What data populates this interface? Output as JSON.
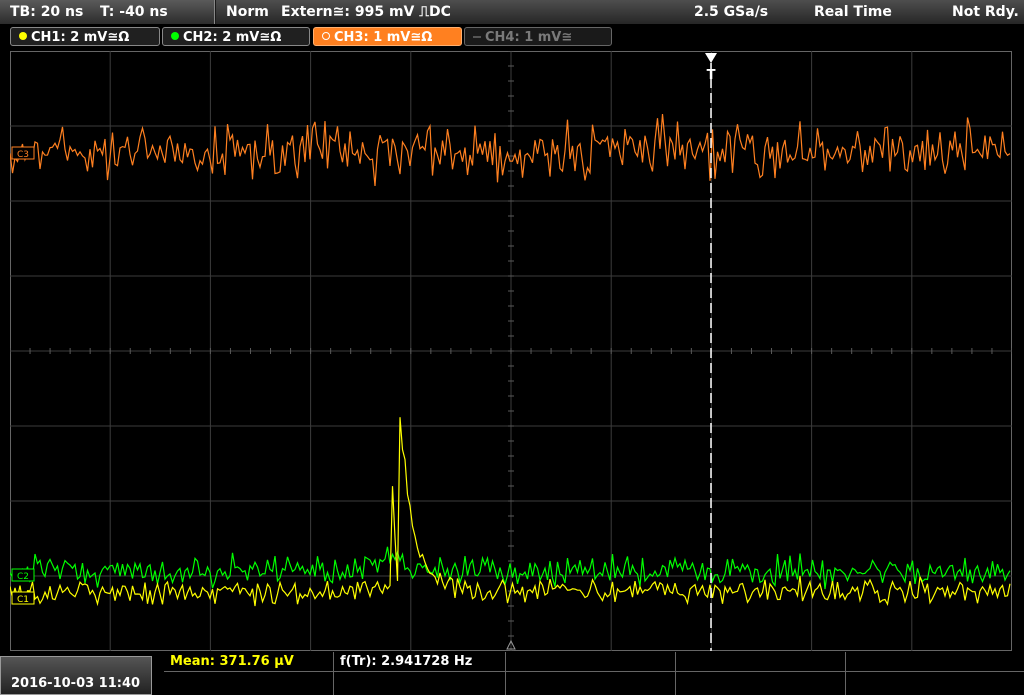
{
  "header": {
    "timebase": "TB: 20 ns",
    "trigger_time": "T: -40 ns",
    "mode": "Norm",
    "trigger_source": "Extern≅: 995 mV ⎍DC",
    "sample_rate": "2.5 GSa/s",
    "acq_mode": "Real Time",
    "status": "Not Rdy."
  },
  "channels": [
    {
      "label": "CH1: 2 mV≅Ω",
      "color": "#ffff00",
      "active": true
    },
    {
      "label": "CH2: 2 mV≅Ω",
      "color": "#00ff00",
      "active": true
    },
    {
      "label": "CH3: 1 mV≅Ω",
      "color": "#ff8020",
      "active": true,
      "selected": true
    },
    {
      "label": "CH4: 1 mV≅",
      "color": "#7a7a7a",
      "active": false
    }
  ],
  "markers": {
    "ch3": "C3",
    "ch2": "C2",
    "ch1": "C1",
    "trigger": "T"
  },
  "measurements": {
    "mean": "Mean: 371.76 µV",
    "freq": "f(Tr): 2.941728 Hz"
  },
  "datetime": "2016-10-03 11:40",
  "colors": {
    "ch1": "#ffff00",
    "ch2": "#00ff00",
    "ch3": "#ff8020",
    "grid": "#3c3c3c"
  }
}
